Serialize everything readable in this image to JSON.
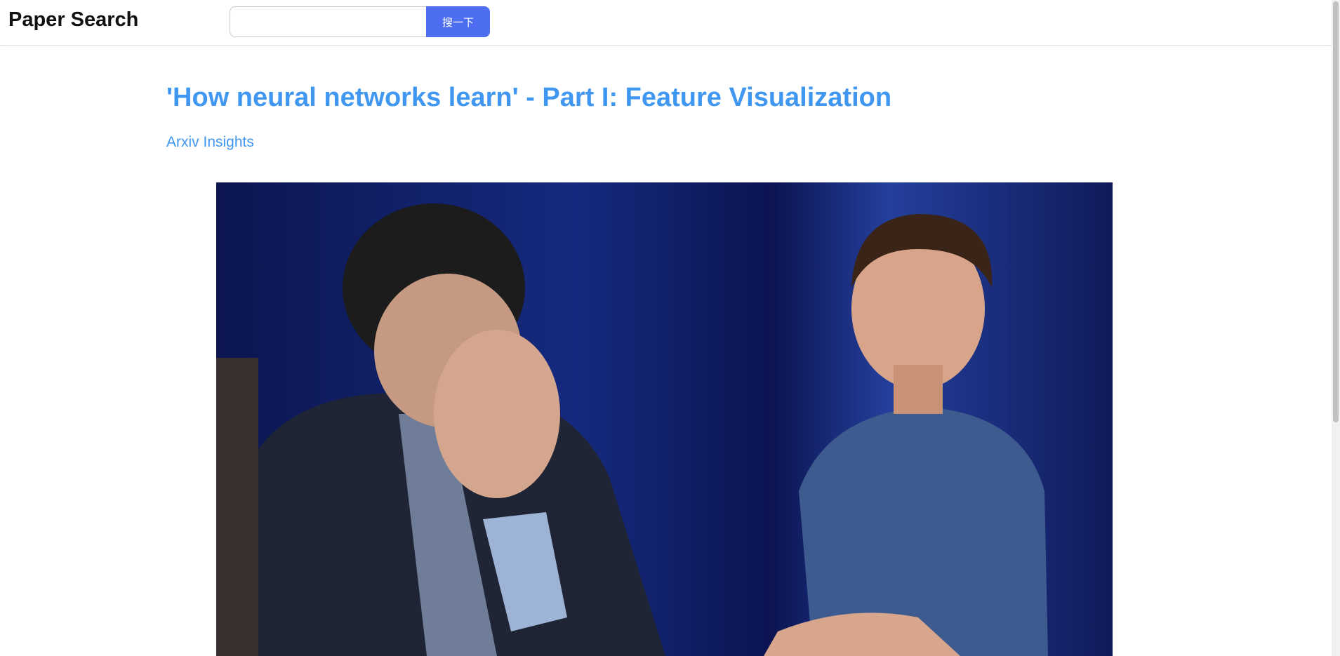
{
  "header": {
    "brand": "Paper Search",
    "search": {
      "value": "",
      "placeholder": "",
      "button_label": "搜一下"
    }
  },
  "main": {
    "title": "'How neural networks learn' - Part I: Feature Visualization",
    "author": "Arxiv Insights",
    "video": {
      "thumbnail": "video-thumbnail-two-people",
      "description": ""
    }
  },
  "colors": {
    "accent": "#3f97f1",
    "button": "#4e6ef2",
    "video_background": "#0f1a55"
  }
}
